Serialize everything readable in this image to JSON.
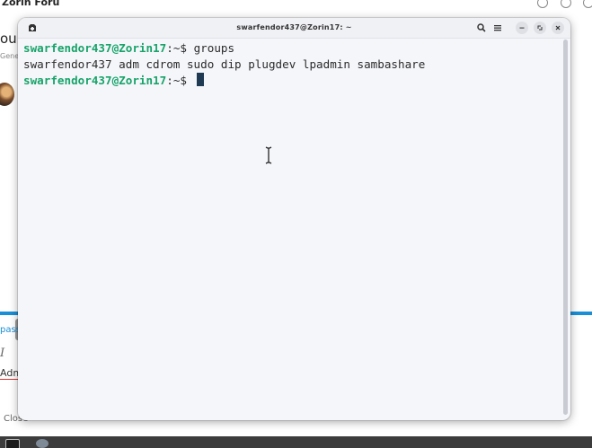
{
  "background": {
    "title_fragment": "Zorin Foru",
    "frag_ou": "ou",
    "frag_gen": "Gene",
    "frag_pass": "pass",
    "frag_italic": "I",
    "frag_adm": "Adm",
    "frag_close": "Close"
  },
  "terminal": {
    "title": "swarfendor437@Zorin17: ~",
    "lines": [
      {
        "user": "swarfendor437@Zorin17",
        "path": ":~$ ",
        "command": "groups"
      },
      {
        "output": "swarfendor437 adm cdrom sudo dip plugdev lpadmin sambashare"
      },
      {
        "user": "swarfendor437@Zorin17",
        "path": ":~$ ",
        "command": ""
      }
    ],
    "buttons": {
      "new_tab": "new-tab-icon",
      "search": "search-icon",
      "menu": "hamburger-menu-icon",
      "minimize": "minimize-icon",
      "maximize": "maximize-icon",
      "close": "close-icon"
    }
  },
  "colors": {
    "prompt_user": "#18a36a",
    "cursor": "#1f3a52",
    "terminal_bg": "#f5f6fa",
    "forum_accent": "#1a8fd6"
  }
}
